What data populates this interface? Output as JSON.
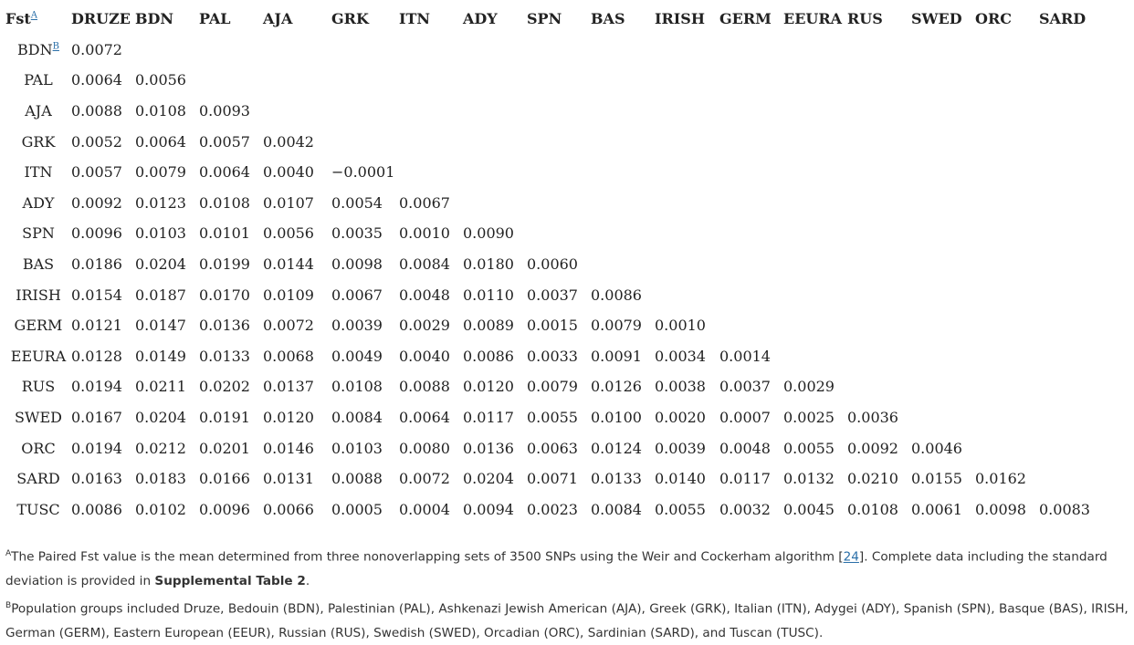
{
  "table": {
    "corner": "Fst",
    "corner_sup": "A",
    "headers": [
      "DRUZE",
      "BDN",
      "PAL",
      "AJA",
      "GRK",
      "ITN",
      "ADY",
      "SPN",
      "BAS",
      "IRISH",
      "GERM",
      "EEURA",
      "RUS",
      "SWED",
      "ORC",
      "SARD"
    ],
    "rows": [
      {
        "label": "BDN",
        "label_sup": "B",
        "values": [
          "0.0072"
        ]
      },
      {
        "label": "PAL",
        "values": [
          "0.0064",
          "0.0056"
        ]
      },
      {
        "label": "AJA",
        "values": [
          "0.0088",
          "0.0108",
          "0.0093"
        ]
      },
      {
        "label": "GRK",
        "values": [
          "0.0052",
          "0.0064",
          "0.0057",
          "0.0042"
        ]
      },
      {
        "label": "ITN",
        "values": [
          "0.0057",
          "0.0079",
          "0.0064",
          "0.0040",
          "−0.0001"
        ]
      },
      {
        "label": "ADY",
        "values": [
          "0.0092",
          "0.0123",
          "0.0108",
          "0.0107",
          "0.0054",
          "0.0067"
        ]
      },
      {
        "label": "SPN",
        "values": [
          "0.0096",
          "0.0103",
          "0.0101",
          "0.0056",
          "0.0035",
          "0.0010",
          "0.0090"
        ]
      },
      {
        "label": "BAS",
        "values": [
          "0.0186",
          "0.0204",
          "0.0199",
          "0.0144",
          "0.0098",
          "0.0084",
          "0.0180",
          "0.0060"
        ]
      },
      {
        "label": "IRISH",
        "values": [
          "0.0154",
          "0.0187",
          "0.0170",
          "0.0109",
          "0.0067",
          "0.0048",
          "0.0110",
          "0.0037",
          "0.0086"
        ]
      },
      {
        "label": "GERM",
        "values": [
          "0.0121",
          "0.0147",
          "0.0136",
          "0.0072",
          "0.0039",
          "0.0029",
          "0.0089",
          "0.0015",
          "0.0079",
          "0.0010"
        ]
      },
      {
        "label": "EEURA",
        "values": [
          "0.0128",
          "0.0149",
          "0.0133",
          "0.0068",
          "0.0049",
          "0.0040",
          "0.0086",
          "0.0033",
          "0.0091",
          "0.0034",
          "0.0014"
        ]
      },
      {
        "label": "RUS",
        "values": [
          "0.0194",
          "0.0211",
          "0.0202",
          "0.0137",
          "0.0108",
          "0.0088",
          "0.0120",
          "0.0079",
          "0.0126",
          "0.0038",
          "0.0037",
          "0.0029"
        ]
      },
      {
        "label": "SWED",
        "values": [
          "0.0167",
          "0.0204",
          "0.0191",
          "0.0120",
          "0.0084",
          "0.0064",
          "0.0117",
          "0.0055",
          "0.0100",
          "0.0020",
          "0.0007",
          "0.0025",
          "0.0036"
        ]
      },
      {
        "label": "ORC",
        "values": [
          "0.0194",
          "0.0212",
          "0.0201",
          "0.0146",
          "0.0103",
          "0.0080",
          "0.0136",
          "0.0063",
          "0.0124",
          "0.0039",
          "0.0048",
          "0.0055",
          "0.0092",
          "0.0046"
        ]
      },
      {
        "label": "SARD",
        "values": [
          "0.0163",
          "0.0183",
          "0.0166",
          "0.0131",
          "0.0088",
          "0.0072",
          "0.0204",
          "0.0071",
          "0.0133",
          "0.0140",
          "0.0117",
          "0.0132",
          "0.0210",
          "0.0155",
          "0.0162"
        ]
      },
      {
        "label": "TUSC",
        "values": [
          "0.0086",
          "0.0102",
          "0.0096",
          "0.0066",
          "0.0005",
          "0.0004",
          "0.0094",
          "0.0023",
          "0.0084",
          "0.0055",
          "0.0032",
          "0.0045",
          "0.0108",
          "0.0061",
          "0.0098",
          "0.0083"
        ]
      }
    ]
  },
  "footnotes": {
    "a_marker": "A",
    "a_text_before": "The Paired Fst value is the mean determined from three nonoverlapping sets of 3500 SNPs using the Weir and Cockerham algorithm [",
    "a_ref": "24",
    "a_text_after": "]. Complete data including the standard deviation is provided in ",
    "a_bold": "Supplemental Table 2",
    "a_end": ".",
    "b_marker": "B",
    "b_text": "Population groups included Druze, Bedouin (BDN), Palestinian (PAL), Ashkenazi Jewish American (AJA), Greek (GRK), Italian (ITN), Adygei (ADY), Spanish (SPN), Basque (BAS), IRISH, German (GERM), Eastern European (EEUR), Russian (RUS), Swedish (SWED), Orcadian (ORC), Sardinian (SARD), and Tuscan (TUSC)."
  }
}
